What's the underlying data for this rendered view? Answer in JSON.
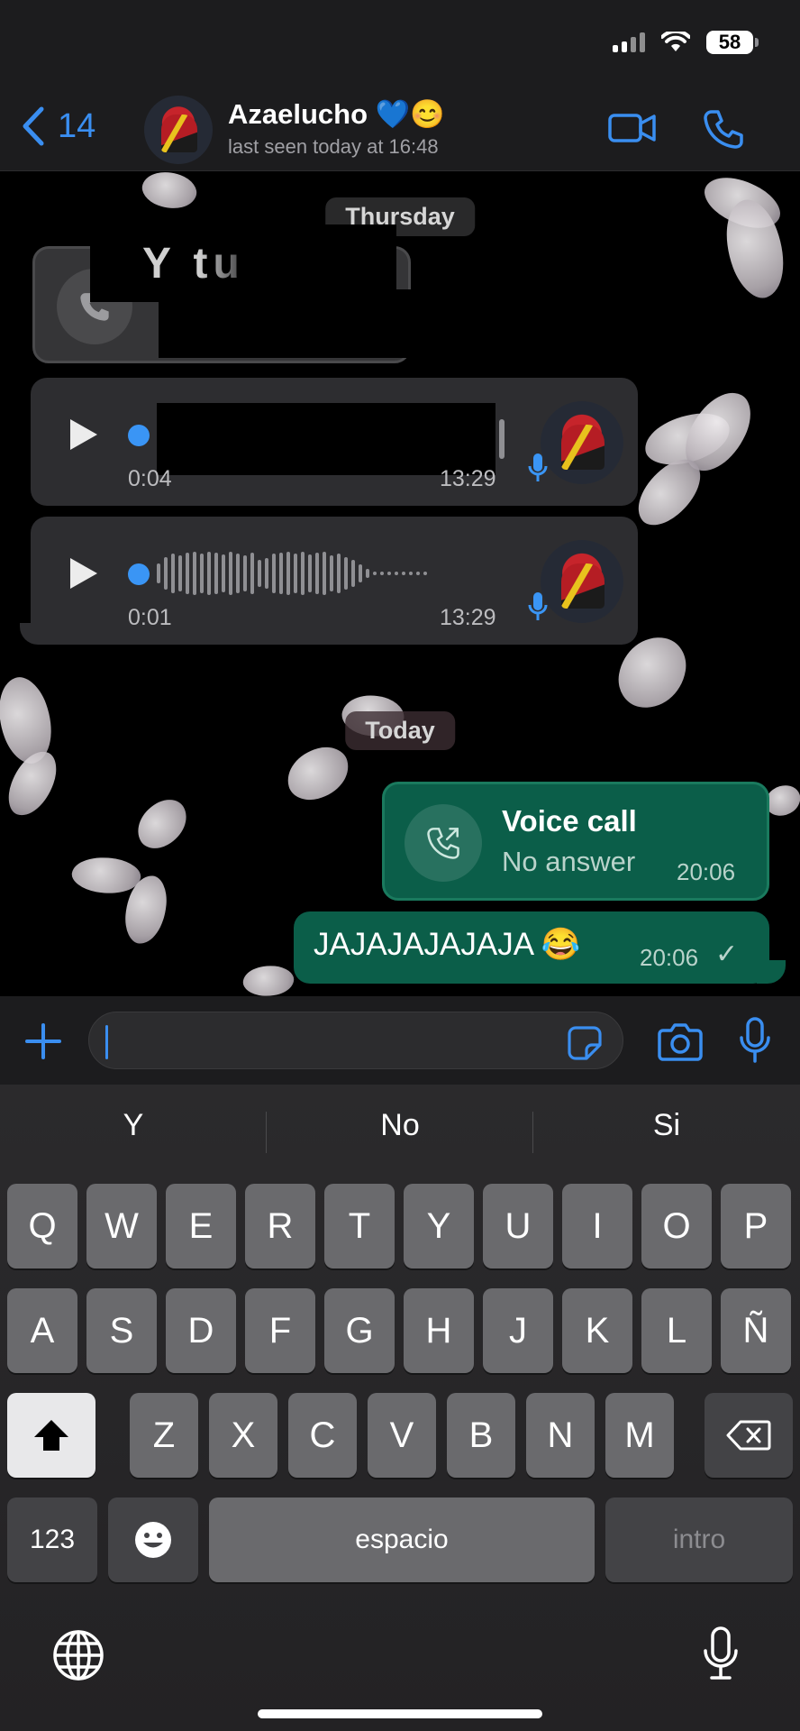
{
  "status_bar": {
    "battery": "58"
  },
  "header": {
    "back_count": "14",
    "contact_name": "Azaelucho 💙😊",
    "contact_status": "last seen today at 16:48"
  },
  "chat": {
    "date_thursday": "Thursday",
    "redacted_fragment": "Y tu",
    "voice_note_1": {
      "duration": "0:04",
      "time": "13:29"
    },
    "voice_note_2": {
      "duration": "0:01",
      "time": "13:29"
    },
    "date_today": "Today",
    "voice_call": {
      "title": "Voice call",
      "subtitle": "No answer",
      "time": "20:06"
    },
    "message": {
      "text": "JAJAJAJAJAJA 😂",
      "time": "20:06",
      "status": "✓"
    }
  },
  "suggestions": [
    "Y",
    "No",
    "Si"
  ],
  "keyboard": {
    "row1": [
      "Q",
      "W",
      "E",
      "R",
      "T",
      "Y",
      "U",
      "I",
      "O",
      "P"
    ],
    "row2": [
      "A",
      "S",
      "D",
      "F",
      "G",
      "H",
      "J",
      "K",
      "L",
      "Ñ"
    ],
    "row3": [
      "Z",
      "X",
      "C",
      "V",
      "B",
      "N",
      "M"
    ],
    "numbers_key": "123",
    "space_key": "espacio",
    "return_key": "intro"
  },
  "colors": {
    "accent": "#3a8ef0",
    "outgoing_bubble": "#0b5e49",
    "incoming_bubble": "#2d2d30"
  },
  "icons": [
    "back-chevron-icon",
    "video-call-icon",
    "phone-icon",
    "play-icon",
    "mic-icon",
    "plus-icon",
    "sticker-icon",
    "camera-icon",
    "shift-icon",
    "delete-icon",
    "emoji-icon",
    "globe-icon",
    "dictation-icon"
  ]
}
